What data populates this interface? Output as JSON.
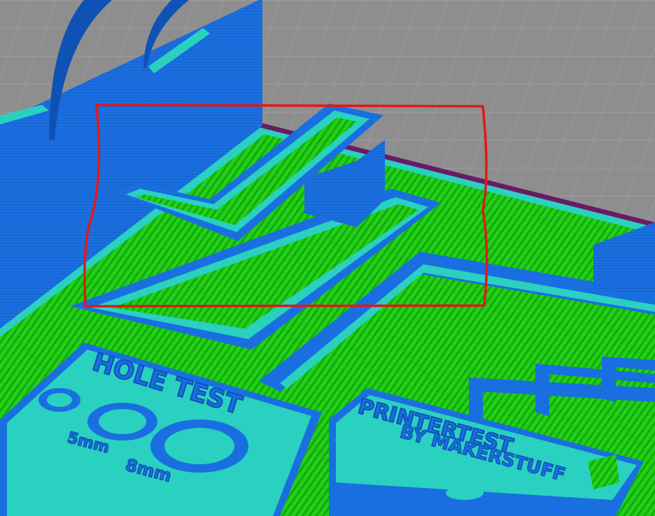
{
  "viewport": {
    "background_color": "#8e8e8e",
    "grid_color": "#a2a2a2"
  },
  "colors": {
    "wall": "#1a6fe0",
    "wall_dark": "#0f52b5",
    "perimeter": "#2ad0c0",
    "infill": "#21d116",
    "infill_dark": "#16a80e",
    "skirt": "#6a1a66",
    "highlight": "#e01818"
  },
  "print_labels": {
    "hole_test": "HOLE TEST",
    "size_5mm": "5mm",
    "size_8mm": "8mm",
    "printer_test": "PRINTERTEST",
    "by_line": "BY MAKERSTUFF"
  },
  "annotation": {
    "shape": "hand-drawn-rectangle"
  }
}
